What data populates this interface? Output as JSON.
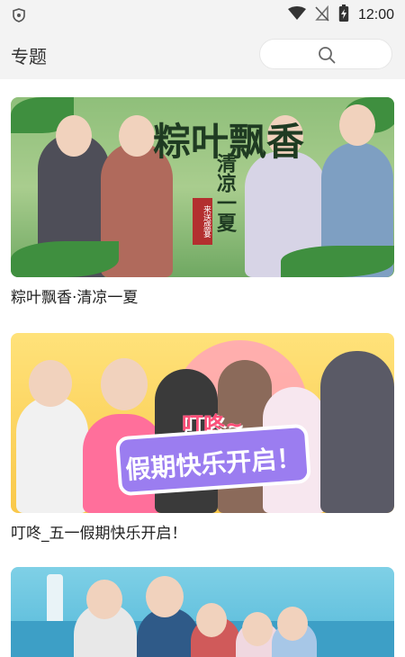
{
  "status_bar": {
    "time": "12:00",
    "icons": [
      "shield-icon",
      "wifi-icon",
      "no-signal-icon",
      "battery-icon"
    ]
  },
  "header": {
    "title": "专题",
    "search_icon": "search-icon"
  },
  "topics": [
    {
      "title": "粽叶飘香·清凉一夏",
      "banner_text_main": "粽叶飘香",
      "banner_text_side": "清凉一夏",
      "banner_stamp": "来送盛宴",
      "accent": "#6fa862"
    },
    {
      "title": "叮咚_五一假期快乐开启！",
      "banner_text_top": "叮咚~",
      "banner_text_main": "假期快乐开启！",
      "accent": "#9b7df0"
    },
    {
      "title": "",
      "accent": "#4fb6d8"
    }
  ]
}
